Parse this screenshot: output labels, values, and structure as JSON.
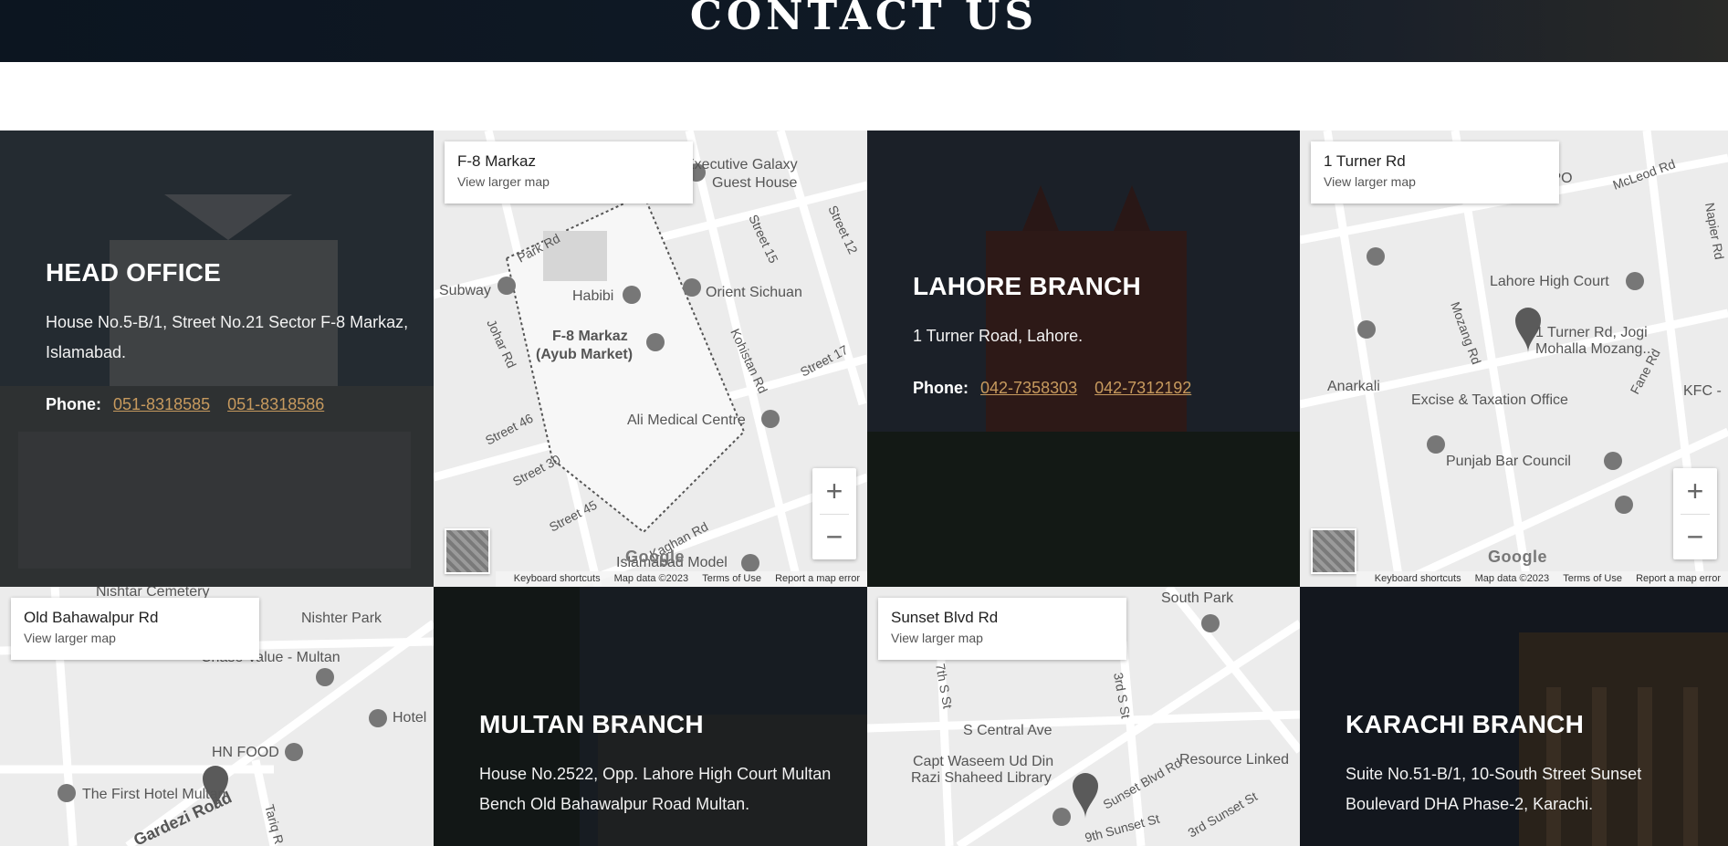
{
  "header": {
    "title": "CONTACT US"
  },
  "offices": [
    {
      "title": "HEAD OFFICE",
      "address": "House No.5-B/1, Street No.21 Sector F-8 Markaz, Islamabad.",
      "phone_label": "Phone:",
      "phones": [
        "051-8318585",
        "051-8318586"
      ]
    },
    {
      "title": "LAHORE BRANCH",
      "address": "1 Turner Road, Lahore.",
      "phone_label": "Phone:",
      "phones": [
        "042-7358303",
        "042-7312192"
      ]
    },
    {
      "title": "MULTAN BRANCH",
      "address": "House No.2522, Opp. Lahore High Court Multan Bench Old Bahawalpur Road Multan."
    },
    {
      "title": "KARACHI BRANCH",
      "address": "Suite No.51-B/1, 10-South Street Sunset Boulevard DHA Phase-2, Karachi."
    }
  ],
  "maps": [
    {
      "place": "F-8 Markaz",
      "link": "View larger map",
      "labels": [
        "Executive Galaxy",
        "Guest House",
        "Park Rd",
        "Subway",
        "Habibi",
        "Orient Sichuan",
        "F-8 Markaz",
        "(Ayub Market)",
        "Johar Rd",
        "Kohistan Rd",
        "Street 15",
        "Street 12",
        "Street 17",
        "Street 46",
        "Street 30",
        "Street 45",
        "Kaghan Rd",
        "Ali Medical Centre",
        "Islamabad Model"
      ],
      "attribution": {
        "shortcuts": "Keyboard shortcuts",
        "data": "Map data ©2023",
        "terms": "Terms of Use",
        "report": "Report a map error"
      }
    },
    {
      "place": "1 Turner Rd",
      "link": "View larger map",
      "labels": [
        "GPO",
        "McLeod Rd",
        "Napier Rd",
        "Lahore High Court",
        "1 Turner Rd, Jogi",
        "Mohalla Mozang...",
        "Mozang Rd",
        "Anarkali",
        "Excise & Taxation Office",
        "Punjab Bar Council",
        "Fane Rd",
        "KFC -"
      ],
      "attribution": {
        "shortcuts": "Keyboard shortcuts",
        "data": "Map data ©2023",
        "terms": "Terms of Use",
        "report": "Report a map error"
      }
    },
    {
      "place": "Old Bahawalpur Rd",
      "link": "View larger map",
      "labels": [
        "Nishtar Cemetery",
        "Nishter Park",
        "Chase Value - Multan",
        "Hotel",
        "HN FOOD",
        "The First Hotel Multan",
        "Gardezi Road",
        "Tariq R"
      ]
    },
    {
      "place": "Sunset Blvd Rd",
      "link": "View larger map",
      "labels": [
        "South Park",
        "S Central Ave",
        "Capt Waseem Ud Din",
        "Razi Shaheed Library",
        "Resource Linked",
        "Sunset Blvd Rd",
        "9th Sunset St",
        "3rd Sunset St",
        "7th S St",
        "3rd S St"
      ]
    }
  ],
  "brand": {
    "google": "Google",
    "accent": "#c79a5e"
  }
}
